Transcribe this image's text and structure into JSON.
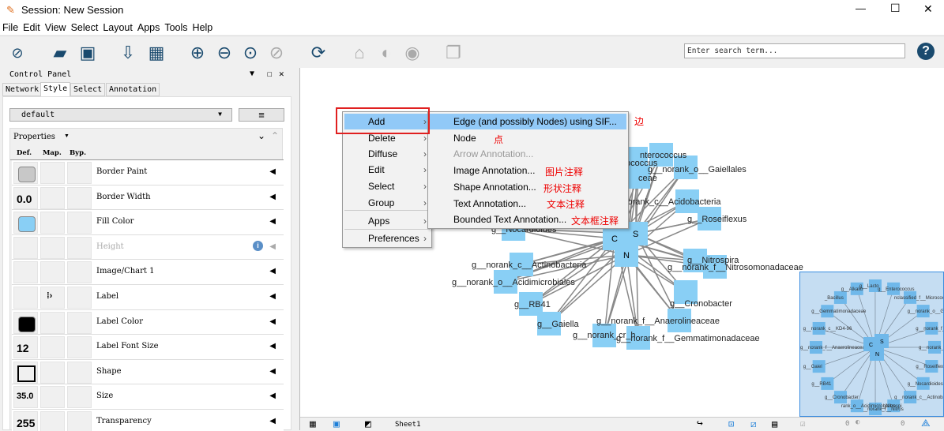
{
  "window": {
    "title": "Session: New Session",
    "controls": {
      "minimize": "—",
      "maximize": "☐",
      "close": "✕"
    }
  },
  "menubar": [
    "File",
    "Edit",
    "View",
    "Select",
    "Layout",
    "Apps",
    "Tools",
    "Help"
  ],
  "toolbar": {
    "icons": [
      "cytoscape-logo-icon",
      "open-folder-icon",
      "save-icon",
      "import-network-icon",
      "import-table-icon",
      "zoom-in-icon",
      "zoom-out-icon",
      "zoom-fit-icon",
      "zoom-selected-icon",
      "refresh-icon",
      "home-icon",
      "hide-icon",
      "show-icon",
      "export-icon"
    ],
    "search_placeholder": "Enter search term...",
    "help": "?"
  },
  "control_panel": {
    "title": "Control Panel",
    "tabs": [
      "Network",
      "Style",
      "Select",
      "Annotation"
    ],
    "active_tab": "Style",
    "style_name": "default",
    "properties_label": "Properties",
    "columns": [
      "Def.",
      "Map.",
      "Byp."
    ],
    "rows": [
      {
        "label": "Border Paint",
        "def": "swatch",
        "color": "#c8c8c8"
      },
      {
        "label": "Border Width",
        "def": "0.0"
      },
      {
        "label": "Fill Color",
        "def": "swatch",
        "color": "#89cff5"
      },
      {
        "label": "Height",
        "def": "",
        "disabled": true,
        "info": true
      },
      {
        "label": "Image/Chart 1",
        "def": ""
      },
      {
        "label": "Label",
        "def": "",
        "mapped": true
      },
      {
        "label": "Label Color",
        "def": "swatch",
        "color": "#000000"
      },
      {
        "label": "Label Font Size",
        "def": "12"
      },
      {
        "label": "Shape",
        "def": "shape"
      },
      {
        "label": "Size",
        "def": "35.0"
      },
      {
        "label": "Transparency",
        "def": "255"
      }
    ]
  },
  "context_menu": {
    "items": [
      "Add",
      "Delete",
      "Diffuse",
      "Edit",
      "Select",
      "Group",
      "Apps",
      "Preferences"
    ],
    "highlighted": "Add",
    "submenu": [
      {
        "label": "Edge (and possibly Nodes) using SIF...",
        "note": "边",
        "highlighted": true
      },
      {
        "label": "Node",
        "note": "点"
      },
      {
        "label": "Arrow Annotation...",
        "disabled": true
      },
      {
        "label": "Image Annotation...",
        "note": "图片注释"
      },
      {
        "label": "Shape Annotation...",
        "note": "形状注释"
      },
      {
        "label": "Text Annotation...",
        "note": "文本注释"
      },
      {
        "label": "Bounded Text Annotation...",
        "note": "文本框注释"
      }
    ]
  },
  "network": {
    "node_color": "#89cff5",
    "edge_color": "#888888",
    "hubs": [
      "C",
      "S",
      "N"
    ],
    "nodes": [
      "nterococcus",
      "ococcus",
      "ceae",
      "g__norank_o__Gaiellales",
      "g__norank_c__Acidobacteria",
      "g__Roseiflexus",
      "g__Nocardioides",
      "g__norank_c__Actinobacteria",
      "g__norank_o__Acidimicrobiales",
      "g__RB41",
      "g__Gaiella",
      "g__norank_cr_h",
      "g__norank_f__Gemmatimonadaceae",
      "g__norank_f__Anaerolineaceae",
      "g__Cronobacter",
      "g__Nitrospira",
      "g__norank_f__Nitrosomonadaceae"
    ]
  },
  "minimap": {
    "labels": [
      "_Bacillus",
      "g__Alkalib",
      "g__Lacto",
      "g__Enterococcus",
      "nclassified_f__Micrococcaceae",
      "g__norank_o__Gaiellales",
      "g__norank_f__JG34-KF-161",
      "g__norank_c__Acidobacteria",
      "g__Roseiflexus",
      "g__Nocardioides",
      "g__norank_c__Actinobacteria",
      "g__Nitrospi",
      "g__norank_f__Nitros",
      "rank_o__Acidimicrobiales",
      "g__Cronobacter",
      "g__RB41",
      "g__Gaiel",
      "g__norank_f__Anaerolineaceae",
      "g__norank_c__KD4-96",
      "g__Gemmatimonadaceae"
    ]
  },
  "statusbar": {
    "sheet": "Sheet1",
    "selected_count": "0",
    "hidden_count": "0"
  }
}
